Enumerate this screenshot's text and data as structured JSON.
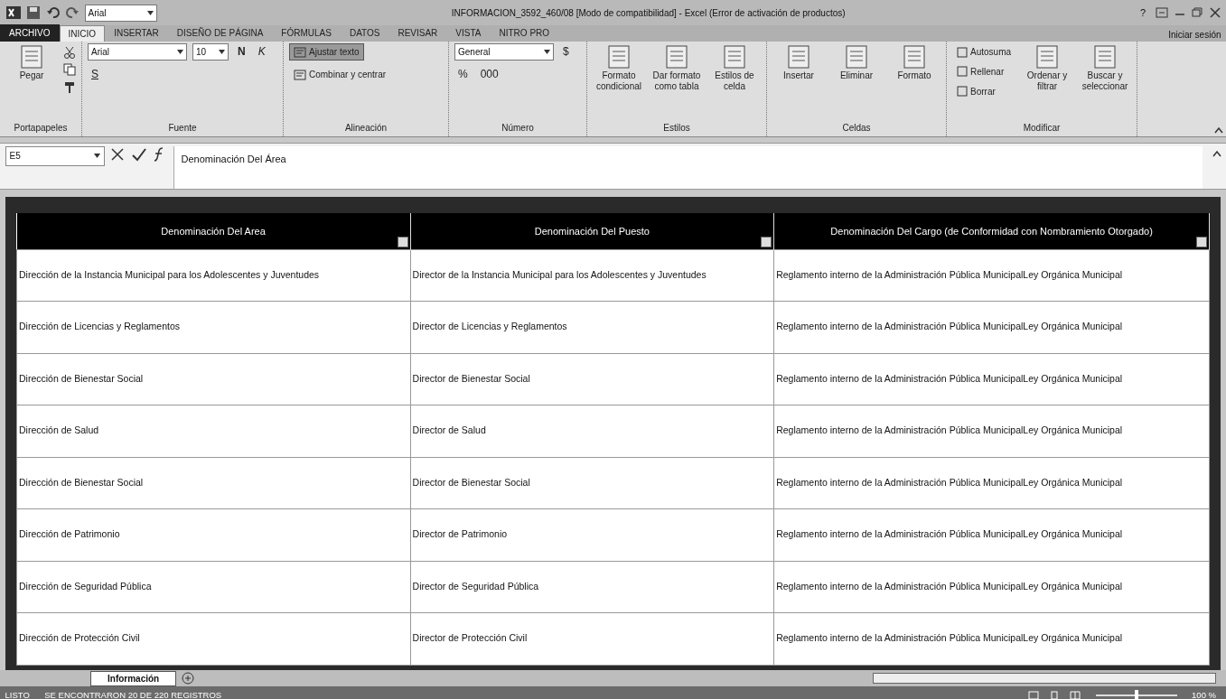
{
  "window": {
    "title": "INFORMACION_3592_460/08 [Modo de compatibilidad] - Excel (Error de activación de productos)",
    "qat_font": "Arial",
    "help": "?"
  },
  "tabs": [
    {
      "label": "ARCHIVO",
      "kind": "file",
      "selected": false
    },
    {
      "label": "INICIO",
      "kind": "tab",
      "selected": true
    },
    {
      "label": "INSERTAR",
      "kind": "tab",
      "selected": false
    },
    {
      "label": "DISEÑO DE PÁGINA",
      "kind": "tab",
      "selected": false
    },
    {
      "label": "FÓRMULAS",
      "kind": "tab",
      "selected": false
    },
    {
      "label": "DATOS",
      "kind": "tab",
      "selected": false
    },
    {
      "label": "REVISAR",
      "kind": "tab",
      "selected": false
    },
    {
      "label": "VISTA",
      "kind": "tab",
      "selected": false
    },
    {
      "label": "NITRO PRO",
      "kind": "tab",
      "selected": false
    }
  ],
  "sign_in": "Iniciar sesión",
  "ribbon": [
    {
      "label": "Portapapeles",
      "items": [
        {
          "kind": "big",
          "label": "Pegar"
        }
      ]
    },
    {
      "label": "Fuente",
      "items": [
        {
          "kind": "wide_combo",
          "value": "Arial"
        },
        {
          "kind": "narrow_combo",
          "value": "10"
        },
        {
          "kind": "bold",
          "label": "N"
        },
        {
          "kind": "italic",
          "label": "K"
        },
        {
          "kind": "underline",
          "label": "S"
        }
      ]
    },
    {
      "label": "Alineación",
      "items": [
        {
          "kind": "toggle",
          "label": "Ajustar texto",
          "selected": true
        },
        {
          "kind": "toggle",
          "label": "Combinar y centrar",
          "selected": false
        }
      ]
    },
    {
      "label": "Número",
      "items": [
        {
          "kind": "wide_combo",
          "value": "General"
        },
        {
          "kind": "symbol",
          "label": "$"
        },
        {
          "kind": "symbol",
          "label": "%"
        },
        {
          "kind": "symbol",
          "label": "000"
        }
      ]
    },
    {
      "label": "Estilos",
      "items": [
        {
          "kind": "big",
          "label": "Formato condicional"
        },
        {
          "kind": "big",
          "label": "Dar formato como tabla"
        },
        {
          "kind": "big",
          "label": "Estilos de celda"
        }
      ]
    },
    {
      "label": "Celdas",
      "items": [
        {
          "kind": "big",
          "label": "Insertar"
        },
        {
          "kind": "big",
          "label": "Eliminar"
        },
        {
          "kind": "big",
          "label": "Formato"
        }
      ]
    },
    {
      "label": "Modificar",
      "items": [
        {
          "kind": "stack",
          "labels": [
            "Autosuma",
            "Rellenar",
            "Borrar"
          ]
        },
        {
          "kind": "big",
          "label": "Ordenar y filtrar"
        },
        {
          "kind": "big",
          "label": "Buscar y seleccionar"
        }
      ]
    }
  ],
  "formula_bar": {
    "name_box": "E5",
    "content": "Denominación Del Área"
  },
  "table": {
    "columns": [
      "Denominación Del Area",
      "Denominación Del Puesto",
      "Denominación Del Cargo (de Conformidad con Nombramiento Otorgado)"
    ],
    "rows": [
      [
        "Dirección de la Instancia Municipal para los Adolescentes y Juventudes",
        "Director de la Instancia Municipal para los Adolescentes y Juventudes",
        "Reglamento interno de la Administración Pública MunicipalLey Orgánica Municipal"
      ],
      [
        "Dirección de Licencias y Reglamentos",
        "Director de Licencias y Reglamentos",
        "Reglamento interno de la Administración Pública MunicipalLey Orgánica Municipal"
      ],
      [
        "Dirección de Bienestar Social",
        "Director de Bienestar Social",
        "Reglamento interno de la Administración Pública MunicipalLey Orgánica Municipal"
      ],
      [
        "Dirección de Salud",
        "Director de Salud",
        "Reglamento interno de la Administración Pública MunicipalLey Orgánica Municipal"
      ],
      [
        "Dirección de Bienestar Social",
        "Director de Bienestar Social",
        "Reglamento interno de la Administración Pública MunicipalLey Orgánica Municipal"
      ],
      [
        "Dirección de Patrimonio",
        "Director de Patrimonio",
        "Reglamento interno de la Administración Pública MunicipalLey Orgánica Municipal"
      ],
      [
        "Dirección de Seguridad Pública",
        "Director de Seguridad Pública",
        "Reglamento interno de la Administración Pública MunicipalLey Orgánica Municipal"
      ],
      [
        "Dirección de Protección Civil",
        "Director de Protección Civil",
        "Reglamento interno de la Administración Pública MunicipalLey Orgánica Municipal"
      ]
    ]
  },
  "sheet_tabs": [
    {
      "label": "Información",
      "selected": true
    }
  ],
  "status_bar": {
    "state": "LISTO",
    "message": "SE ENCONTRARON 20 DE 220 REGISTROS",
    "zoom_slider": {
      "level": 0.5
    },
    "zoom": "100 %"
  }
}
